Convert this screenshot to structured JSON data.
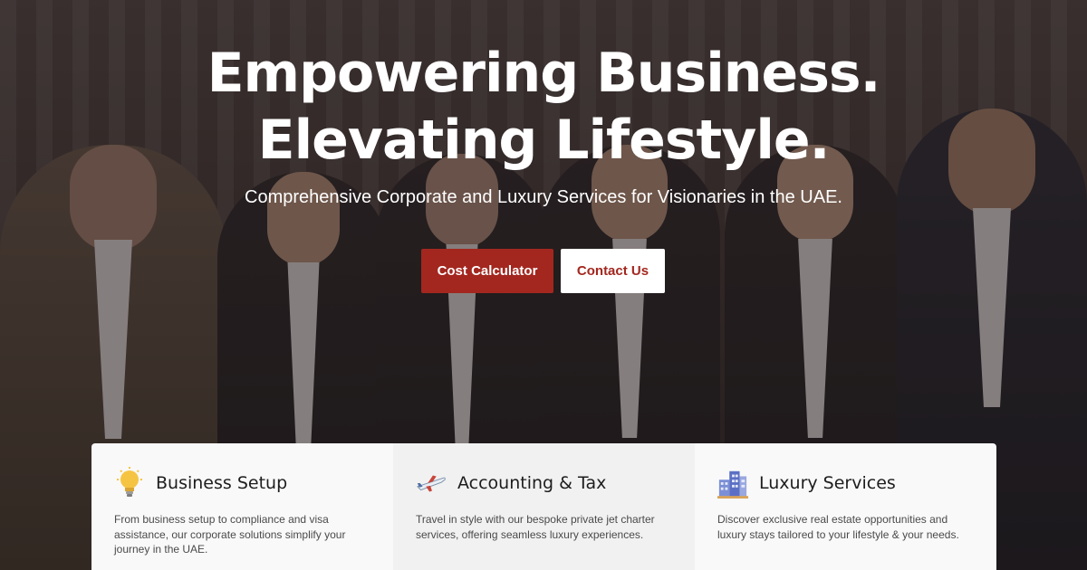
{
  "hero": {
    "headline_line1": "Empowering Business.",
    "headline_line2": "Elevating Lifestyle.",
    "subheadline": "Comprehensive Corporate and Luxury Services for Visionaries in the UAE.",
    "primary_button": "Cost Calculator",
    "secondary_button": "Contact Us"
  },
  "colors": {
    "accent": "#a3271f",
    "card_bg": "#f9f9f9",
    "card_bg_alt": "#f1f1f1"
  },
  "cards": [
    {
      "icon": "lightbulb-icon",
      "title": "Business Setup",
      "text": "From business setup to compliance and visa assistance, our corporate solutions simplify your journey in the UAE."
    },
    {
      "icon": "airplane-icon",
      "title": "Accounting & Tax",
      "text": "Travel in style with our bespoke private jet charter services, offering seamless luxury experiences."
    },
    {
      "icon": "buildings-icon",
      "title": "Luxury Services",
      "text": "Discover exclusive real estate opportunities and luxury stays tailored to your lifestyle & your needs."
    }
  ]
}
